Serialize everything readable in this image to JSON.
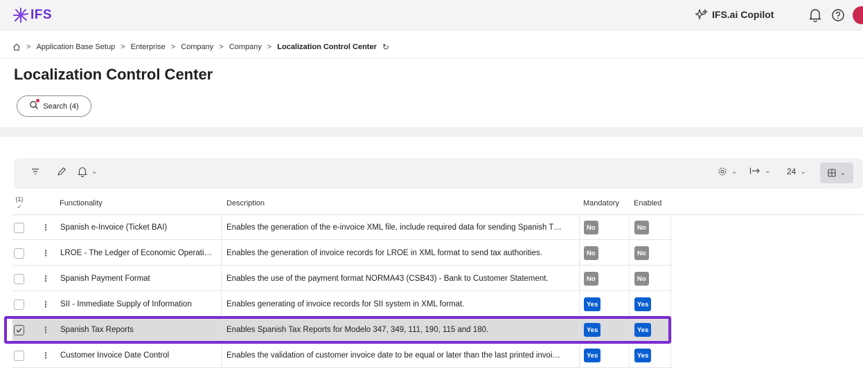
{
  "app": {
    "logo_text": "IFS",
    "brand_color": "#6b2fd6"
  },
  "header": {
    "copilot_label": "IFS.ai Copilot"
  },
  "breadcrumb": {
    "items": [
      "Application Base Setup",
      "Enterprise",
      "Company",
      "Company"
    ],
    "current": "Localization Control Center"
  },
  "page": {
    "title": "Localization Control Center"
  },
  "search": {
    "label": "Search (4)"
  },
  "toolbar": {
    "page_size": "24"
  },
  "table": {
    "selection_count": "(1)",
    "columns": [
      "Functionality",
      "Description",
      "Mandatory",
      "Enabled"
    ],
    "rows": [
      {
        "functionality": "Spanish e-Invoice (Ticket BAI)",
        "description": "Enables the generation of the e-invoice XML file, include required data for sending Spanish T…",
        "mandatory": "No",
        "enabled": "No",
        "selected": false
      },
      {
        "functionality": "LROE - The Ledger of Economic Operati…",
        "description": "Enables the generation of invoice records for LROE in XML format to send tax authorities.",
        "mandatory": "No",
        "enabled": "No",
        "selected": false
      },
      {
        "functionality": "Spanish Payment Format",
        "description": "Enables the use of the payment format NORMA43 (CSB43) - Bank to Customer Statement.",
        "mandatory": "No",
        "enabled": "No",
        "selected": false
      },
      {
        "functionality": "SII - Immediate Supply of Information",
        "description": "Enables generating of invoice records for SII system in XML format.",
        "mandatory": "Yes",
        "enabled": "Yes",
        "selected": false
      },
      {
        "functionality": "Spanish Tax Reports",
        "description": "Enables Spanish Tax Reports for Modelo 347, 349, 111, 190, 115 and 180.",
        "mandatory": "Yes",
        "enabled": "Yes",
        "selected": true
      },
      {
        "functionality": "Customer Invoice Date Control",
        "description": "Enables the validation of customer invoice date to be equal or later than the last printed invoi…",
        "mandatory": "Yes",
        "enabled": "Yes",
        "selected": false
      }
    ]
  }
}
